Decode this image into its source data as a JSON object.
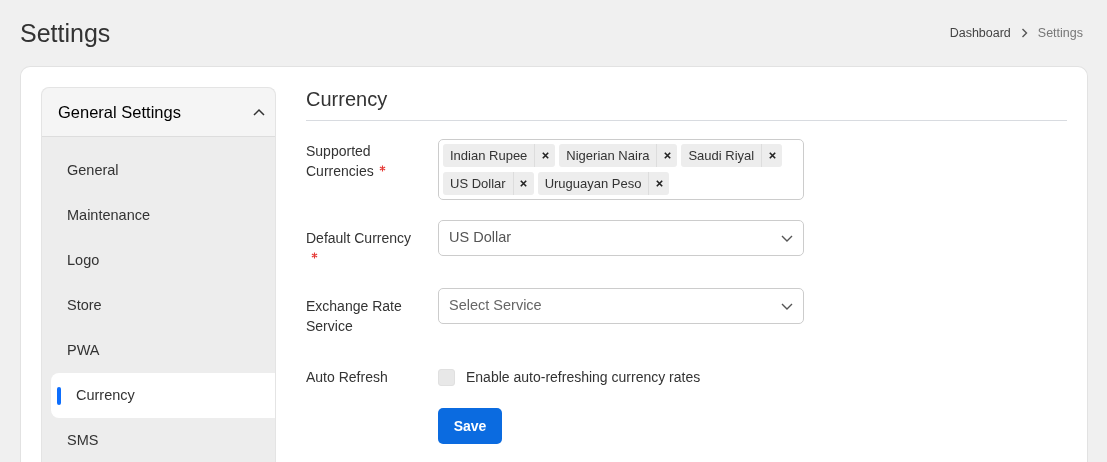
{
  "page": {
    "title": "Settings"
  },
  "breadcrumb": [
    {
      "label": "Dashboard",
      "current": false
    },
    {
      "label": "Settings",
      "current": true
    }
  ],
  "sidebar": {
    "title": "General Settings",
    "expanded": true,
    "items": [
      {
        "label": "General",
        "selected": false
      },
      {
        "label": "Maintenance",
        "selected": false
      },
      {
        "label": "Logo",
        "selected": false
      },
      {
        "label": "Store",
        "selected": false
      },
      {
        "label": "PWA",
        "selected": false
      },
      {
        "label": "Currency",
        "selected": true
      },
      {
        "label": "SMS",
        "selected": false
      }
    ]
  },
  "section": {
    "title": "Currency"
  },
  "fields": [
    {
      "kind": "tags",
      "label": "Supported Currencies",
      "required": true,
      "tags": [
        "Indian Rupee",
        "Nigerian Naira",
        "Saudi Riyal",
        "US Dollar",
        "Uruguayan Peso"
      ]
    },
    {
      "kind": "select",
      "label": "Default Currency",
      "required": true,
      "value": "US Dollar"
    },
    {
      "kind": "select",
      "label": "Exchange Rate Service",
      "required": false,
      "placeholder": "Select Service"
    },
    {
      "kind": "checkbox",
      "label": "Auto Refresh",
      "required": false,
      "checked": false,
      "text": "Enable auto-refreshing currency rates"
    }
  ],
  "save_button": "Save"
}
